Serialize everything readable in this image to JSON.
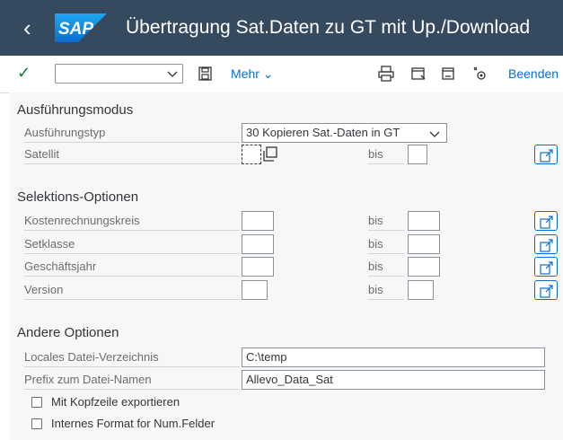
{
  "header": {
    "title": "Übertragung Sat.Daten zu GT mit Up./Download",
    "logo_text": "SAP"
  },
  "toolbar": {
    "command_value": "",
    "more_label": "Mehr",
    "exit_label": "Beenden"
  },
  "sections": {
    "execution_mode": {
      "title": "Ausführungsmodus",
      "execution_type_label": "Ausführungstyp",
      "execution_type_value": "30 Kopieren Sat.-Daten in GT",
      "satellite_label": "Satellit",
      "satellite_from": "",
      "satellite_to": "",
      "bis_label": "bis"
    },
    "selection": {
      "title": "Selektions-Optionen",
      "rows": [
        {
          "label": "Kostenrechnungskreis",
          "from": "",
          "bis": "bis",
          "to": ""
        },
        {
          "label": "Setklasse",
          "from": "",
          "bis": "bis",
          "to": ""
        },
        {
          "label": "Geschäftsjahr",
          "from": "",
          "bis": "bis",
          "to": ""
        },
        {
          "label": "Version",
          "from": "",
          "bis": "bis",
          "to": ""
        }
      ]
    },
    "other": {
      "title": "Andere Optionen",
      "dir_label": "Locales Datei-Verzeichnis",
      "dir_value": "C:\\temp",
      "prefix_label": "Prefix zum Datei-Namen",
      "prefix_value": "Allevo_Data_Sat",
      "cb_header_label": "Mit Kopfzeile exportieren",
      "cb_header_checked": false,
      "cb_internal_label": "Internes Format for Num.Felder",
      "cb_internal_checked": false
    }
  },
  "colors": {
    "shell": "#354a5f",
    "accent": "#0a6ed1",
    "check_green": "#107e3e",
    "logo_blue": "#0a6ed1"
  },
  "icons": [
    "back-icon",
    "sap-logo",
    "check-icon",
    "chevron-down-icon",
    "save-icon",
    "print-icon",
    "find-icon",
    "find-next-icon",
    "settings-icon",
    "multiple-selection-icon",
    "value-help-icon"
  ]
}
